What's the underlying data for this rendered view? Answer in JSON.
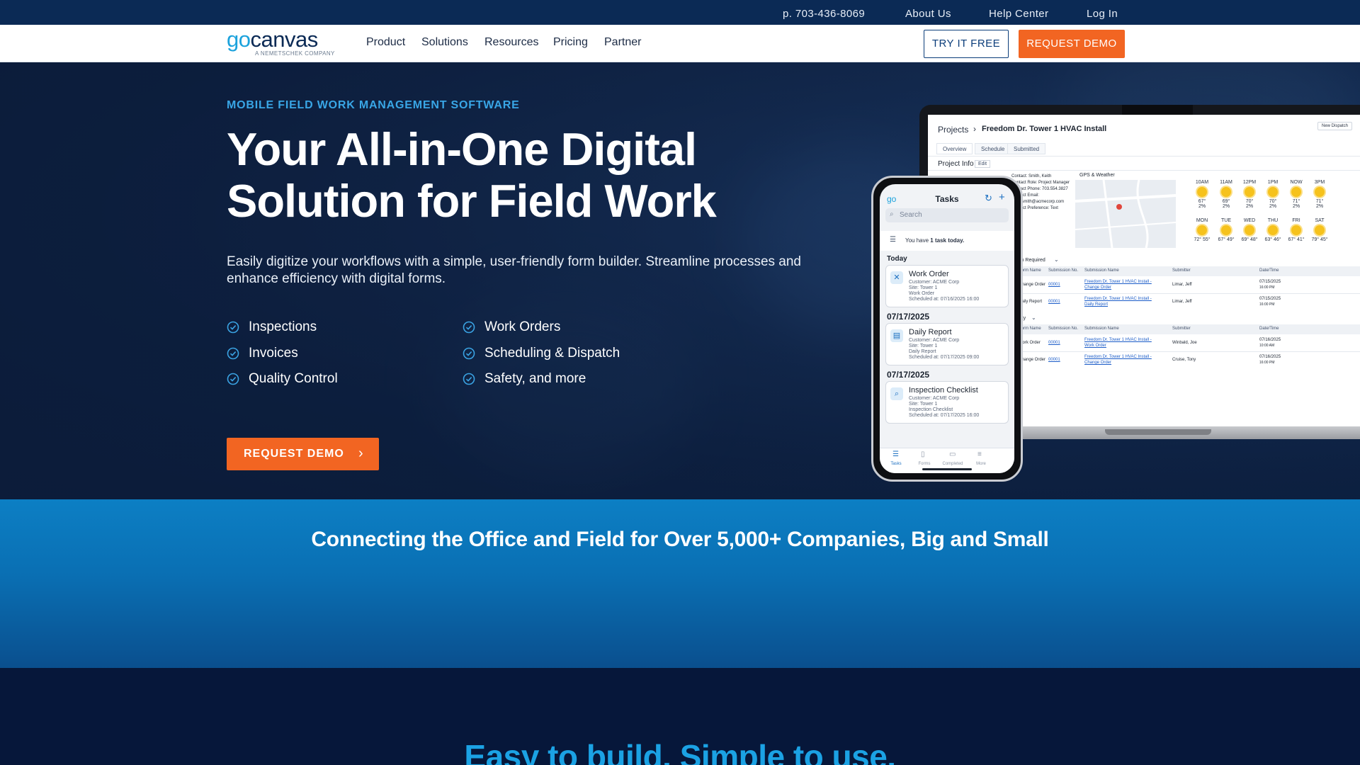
{
  "topbar": {
    "phone": "p. 703-436-8069",
    "about": "About Us",
    "help": "Help Center",
    "login": "Log In"
  },
  "logo": {
    "go": "go",
    "canvas": "canvas",
    "tagline": "A NEMETSCHEK COMPANY"
  },
  "nav": {
    "items": [
      "Product",
      "Solutions",
      "Resources",
      "Pricing",
      "Partner"
    ],
    "try_free": "TRY IT FREE",
    "request_demo": "REQUEST DEMO"
  },
  "hero": {
    "eyebrow": "MOBILE FIELD WORK MANAGEMENT SOFTWARE",
    "headline_line1": "Your All-in-One Digital",
    "headline_line2": "Solution for Field Work",
    "subtext": "Easily digitize your workflows with a simple, user-friendly form builder. Streamline processes and enhance efficiency with digital forms.",
    "features": [
      "Inspections",
      "Invoices",
      "Quality Control",
      "Work Orders",
      "Scheduling & Dispatch",
      "Safety, and more"
    ],
    "cta": "REQUEST DEMO",
    "cta_icon": "chevron-right-icon"
  },
  "laptop_screen": {
    "breadcrumb_root": "Projects",
    "breadcrumb_sep": "›",
    "project_title": "Freedom Dr. Tower 1 HVAC Install",
    "new_dispatch": "New Dispatch",
    "tabs": [
      "Overview",
      "Schedule",
      "Submitted"
    ],
    "project_info": "Project Info",
    "edit": "Edit",
    "contact": {
      "contact": "Contact: Smith, Keith",
      "role": "Contact Role: Project Manager",
      "phone": "Contact Phone: 703.554.3827",
      "email_label": "Contact Email:",
      "email": "keith.smith@acmecorp.com",
      "pref": "Contact Preference: Text"
    },
    "gps_weather": "GPS & Weather",
    "hourly": [
      {
        "time": "10AM",
        "temp": "67°",
        "rain": "2%"
      },
      {
        "time": "11AM",
        "temp": "69°",
        "rain": "2%"
      },
      {
        "time": "12PM",
        "temp": "70°",
        "rain": "2%"
      },
      {
        "time": "1PM",
        "temp": "70°",
        "rain": "2%"
      },
      {
        "time": "NOW",
        "temp": "71°",
        "rain": "2%"
      },
      {
        "time": "3PM",
        "temp": "71°",
        "rain": "2%"
      }
    ],
    "daily": [
      {
        "day": "MON",
        "temps": "72° 55°"
      },
      {
        "day": "TUE",
        "temps": "67° 49°"
      },
      {
        "day": "WED",
        "temps": "69° 48°"
      },
      {
        "day": "THU",
        "temps": "63° 46°"
      },
      {
        "day": "FRI",
        "temps": "67° 41°"
      },
      {
        "day": "SAT",
        "temps": "79° 45°"
      }
    ],
    "action_required": "Action Required",
    "activity": "Activity",
    "columns": [
      "Form Name",
      "Submission No.",
      "Submission Name",
      "Submitter",
      "Date/Time"
    ],
    "action_rows": [
      {
        "form": "Change Order",
        "no": "00001",
        "name1": "Freedom Dr. Tower 1 HVAC Install -",
        "name2": "Change Order",
        "submitter": "Limar, Jeff",
        "date1": "07/15/2025",
        "date2": "16:00 PM"
      },
      {
        "form": "Daily Report",
        "no": "00001",
        "name1": "Freedom Dr. Tower 1 HVAC Install -",
        "name2": "Daily Report",
        "submitter": "Limar, Jeff",
        "date1": "07/15/2025",
        "date2": "16:00 PM"
      }
    ],
    "activity_rows": [
      {
        "form": "Work Order",
        "no": "00001",
        "name1": "Freedom Dr. Tower 1 HVAC Install -",
        "name2": "Work Order",
        "submitter": "Winbald, Joe",
        "date1": "07/16/2025",
        "date2": "10:00 AM"
      },
      {
        "form": "Change Order",
        "no": "00001",
        "name1": "Freedom Dr. Tower 1 HVAC Install -",
        "name2": "Change Order",
        "submitter": "Cruise, Tony",
        "date1": "07/16/2025",
        "date2": "16:00 PM"
      }
    ]
  },
  "phone_screen": {
    "logo": "go",
    "title": "Tasks",
    "search_placeholder": "Search",
    "task_notice_pre": "You have ",
    "task_notice_bold": "1 task today.",
    "today": "Today",
    "date1": "07/17/2025",
    "date2": "07/17/2025",
    "cards": [
      {
        "title": "Work Order",
        "lines": [
          "Customer: ACME Corp",
          "Site: Tower 1",
          "Work Order",
          "Scheduled at: 07/16/2025 16:00"
        ]
      },
      {
        "title": "Daily Report",
        "lines": [
          "Customer: ACME Corp",
          "Site: Tower 1",
          "Daily Report",
          "Scheduled at: 07/17/2025 09:00"
        ]
      },
      {
        "title": "Inspection Checklist",
        "lines": [
          "Customer: ACME Corp",
          "Site: Tower 1",
          "Inspection Checklist",
          "Scheduled at: 07/17/2025 16:00"
        ]
      }
    ],
    "tabs": [
      "Tasks",
      "Forms",
      "Completed",
      "More"
    ]
  },
  "band": {
    "title": "Connecting the Office and Field for Over 5,000+ Companies, Big and Small"
  },
  "bottom": {
    "title": "Easy to build. Simple to use."
  },
  "colors": {
    "brand_navy": "#0b2a55",
    "accent_orange": "#f26522",
    "accent_blue": "#1ba2dc"
  }
}
